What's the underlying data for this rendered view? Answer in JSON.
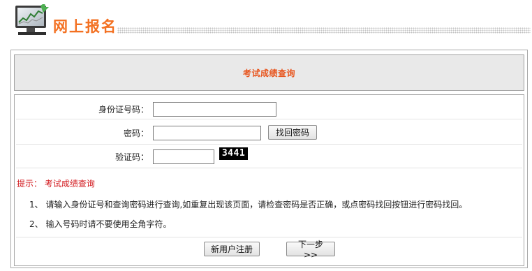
{
  "header": {
    "title": "网上报名",
    "icon": "monitor-chart-icon"
  },
  "panel": {
    "title": "考试成绩查询"
  },
  "form": {
    "id_label": "身份证号码：",
    "id_value": "",
    "password_label": "密码：",
    "password_value": "",
    "recover_button": "找回密码",
    "captcha_label": "验证码：",
    "captcha_value": "",
    "captcha_image_text": "3441"
  },
  "tips": {
    "title": "提示：  考试成绩查询",
    "notes": [
      "1、 请输入身份证号和查询密码进行查询,如重复出现该页面，请检查密码是否正确，或点密码找回按钮进行密码找回。",
      "2、 输入号码时请不要使用全角字符。"
    ]
  },
  "actions": {
    "register_button": "新用户注册",
    "next_button": "下一步>>"
  },
  "colors": {
    "brand_orange": "#f37021",
    "title_orange": "#e8541c",
    "tip_red": "#d2191e",
    "panel_gray": "#e9e9e9"
  }
}
